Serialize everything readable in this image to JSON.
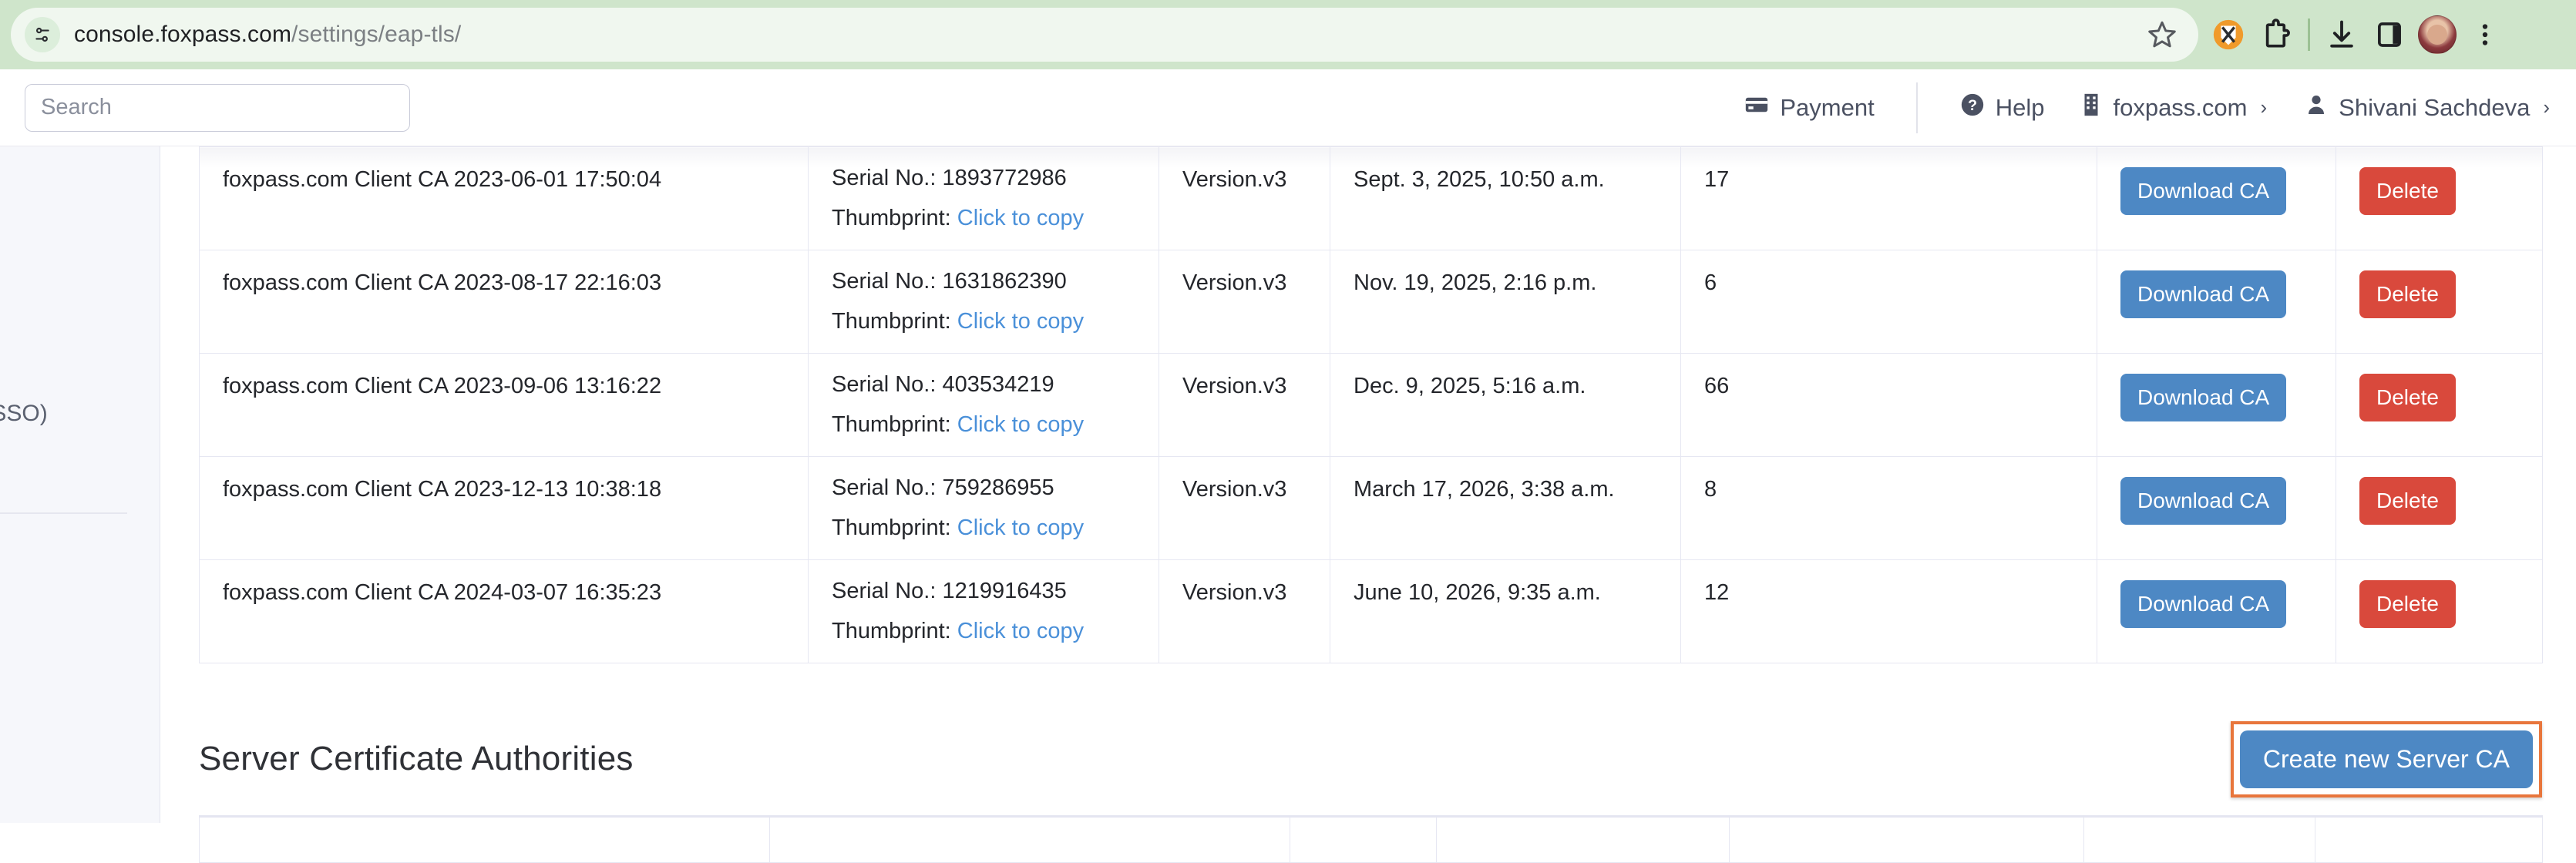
{
  "browser": {
    "url_host": "console.foxpass.com",
    "url_path": "/settings/eap-tls/",
    "icons": {
      "site_info": "tune-icon",
      "bookmark": "star-icon",
      "extension_orange": "adblock-extension-icon",
      "extensions": "puzzle-piece-icon",
      "downloads": "download-icon",
      "side_panel": "side-panel-icon",
      "profile": "avatar-icon",
      "menu": "three-dot-menu-icon"
    }
  },
  "app_header": {
    "search_placeholder": "Search",
    "search_value": "",
    "payment_label": "Payment",
    "help_label": "Help",
    "org_label": "foxpass.com",
    "user_label": "Shivani Sachdeva",
    "chevron": "›"
  },
  "sidebar": {
    "visible_item_label": "On (SSO)"
  },
  "client_ca_table": {
    "labels": {
      "serial_prefix": "Serial No.:",
      "thumbprint_prefix": "Thumbprint:",
      "copy_link": "Click to copy",
      "download_label": "Download CA",
      "delete_label": "Delete"
    },
    "rows": [
      {
        "name": "foxpass.com Client CA 2023-06-01 17:50:04",
        "serial": "1893772986",
        "version": "Version.v3",
        "date": "Sept. 3, 2025, 10:50 a.m.",
        "count": "17"
      },
      {
        "name": "foxpass.com Client CA 2023-08-17 22:16:03",
        "serial": "1631862390",
        "version": "Version.v3",
        "date": "Nov. 19, 2025, 2:16 p.m.",
        "count": "6"
      },
      {
        "name": "foxpass.com Client CA 2023-09-06 13:16:22",
        "serial": "403534219",
        "version": "Version.v3",
        "date": "Dec. 9, 2025, 5:16 a.m.",
        "count": "66"
      },
      {
        "name": "foxpass.com Client CA 2023-12-13 10:38:18",
        "serial": "759286955",
        "version": "Version.v3",
        "date": "March 17, 2026, 3:38 a.m.",
        "count": "8"
      },
      {
        "name": "foxpass.com Client CA 2024-03-07 16:35:23",
        "serial": "1219916435",
        "version": "Version.v3",
        "date": "June 10, 2026, 9:35 a.m.",
        "count": "12"
      }
    ]
  },
  "server_section": {
    "title": "Server Certificate Authorities",
    "create_button_label": "Create new Server CA"
  },
  "colors": {
    "primary_button": "#4d88c4",
    "danger_button": "#d9493c",
    "link": "#4a90d9",
    "highlight_border": "#e8763c",
    "browser_chrome": "#cfe5cb"
  }
}
